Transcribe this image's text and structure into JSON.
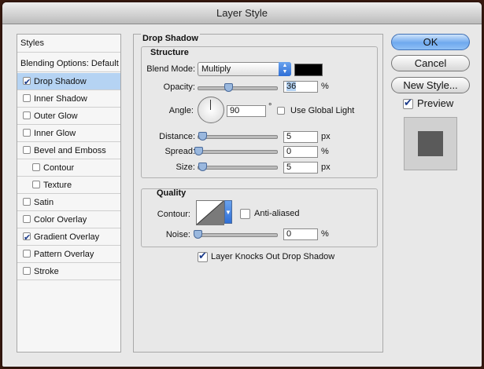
{
  "window": {
    "title": "Layer Style"
  },
  "styles_list": {
    "header": "Styles",
    "blending": "Blending Options: Default",
    "items": [
      {
        "label": "Drop Shadow",
        "checked": true,
        "selected": true,
        "indent": false
      },
      {
        "label": "Inner Shadow",
        "checked": false,
        "selected": false,
        "indent": false
      },
      {
        "label": "Outer Glow",
        "checked": false,
        "selected": false,
        "indent": false
      },
      {
        "label": "Inner Glow",
        "checked": false,
        "selected": false,
        "indent": false
      },
      {
        "label": "Bevel and Emboss",
        "checked": false,
        "selected": false,
        "indent": false
      },
      {
        "label": "Contour",
        "checked": false,
        "selected": false,
        "indent": true
      },
      {
        "label": "Texture",
        "checked": false,
        "selected": false,
        "indent": true
      },
      {
        "label": "Satin",
        "checked": false,
        "selected": false,
        "indent": false
      },
      {
        "label": "Color Overlay",
        "checked": false,
        "selected": false,
        "indent": false
      },
      {
        "label": "Gradient Overlay",
        "checked": true,
        "selected": false,
        "indent": false
      },
      {
        "label": "Pattern Overlay",
        "checked": false,
        "selected": false,
        "indent": false
      },
      {
        "label": "Stroke",
        "checked": false,
        "selected": false,
        "indent": false
      }
    ]
  },
  "drop_shadow": {
    "title": "Drop Shadow",
    "structure": {
      "title": "Structure",
      "blend_mode_label": "Blend Mode:",
      "blend_mode_value": "Multiply",
      "shadow_color": "#000000",
      "opacity_label": "Opacity:",
      "opacity_value": "36",
      "opacity_unit": "%",
      "angle_label": "Angle:",
      "angle_value": "90",
      "angle_unit": "°",
      "global_light_label": "Use Global Light",
      "distance_label": "Distance:",
      "distance_value": "5",
      "distance_unit": "px",
      "spread_label": "Spread:",
      "spread_value": "0",
      "spread_unit": "%",
      "size_label": "Size:",
      "size_value": "5",
      "size_unit": "px"
    },
    "quality": {
      "title": "Quality",
      "contour_label": "Contour:",
      "anti_aliased_label": "Anti-aliased",
      "noise_label": "Noise:",
      "noise_value": "0",
      "noise_unit": "%"
    },
    "knocks_out_label": "Layer Knocks Out Drop Shadow"
  },
  "buttons": {
    "ok": "OK",
    "cancel": "Cancel",
    "new_style": "New Style...",
    "preview_label": "Preview"
  },
  "colors": {
    "accent": "#6fa9ee",
    "selection": "#b5d3f3"
  }
}
